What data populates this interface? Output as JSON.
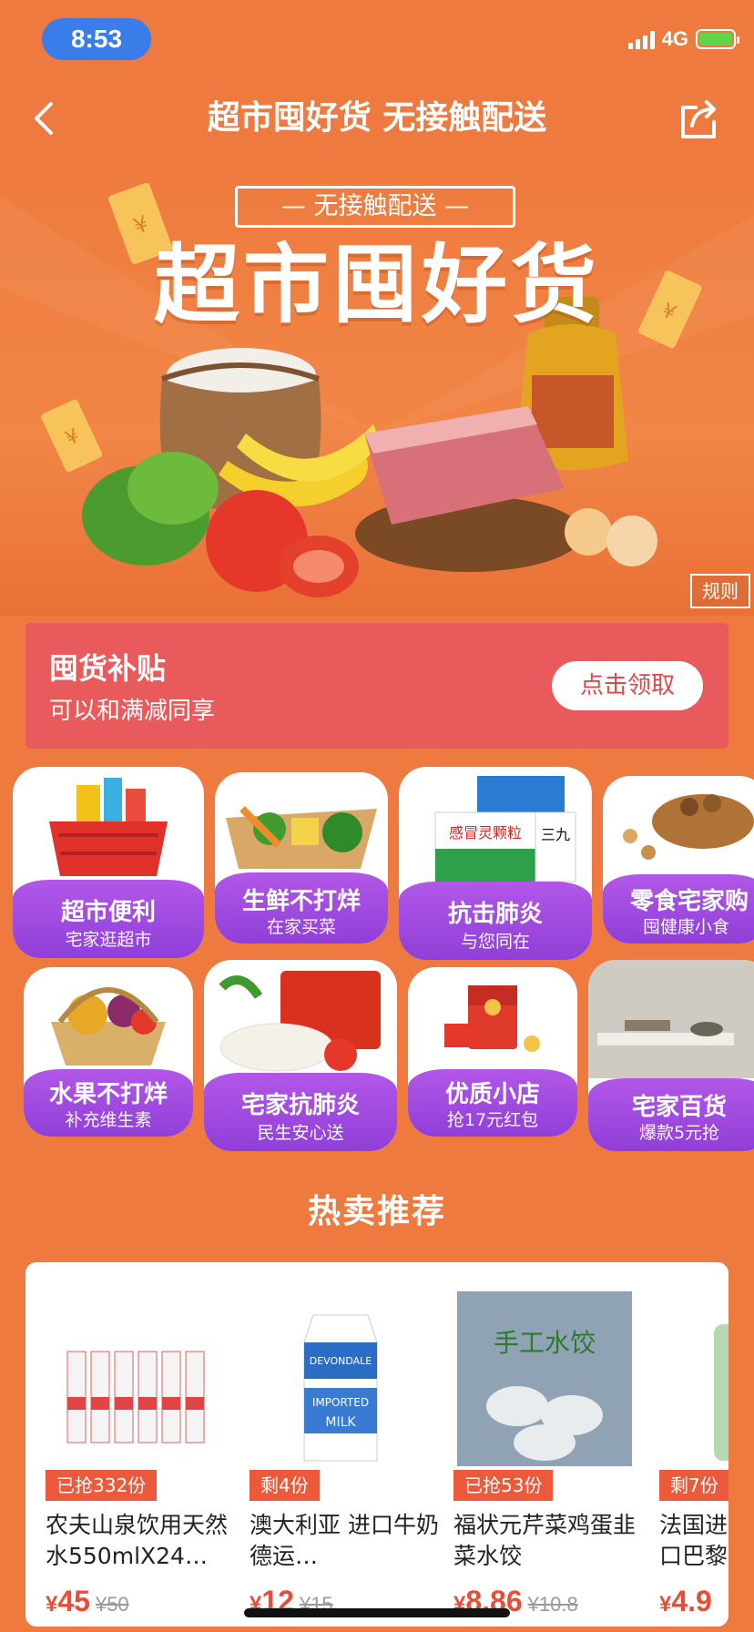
{
  "status": {
    "time": "8:53",
    "network": "4G"
  },
  "nav": {
    "title": "超市囤好货 无接触配送",
    "back_icon": "back-arrow-icon",
    "share_icon": "share-icon"
  },
  "hero": {
    "tag": "— 无接触配送 —",
    "title": "超市囤好货",
    "rules": "规则"
  },
  "coupon": {
    "title": "囤货补贴",
    "subtitle": "可以和满减同享",
    "button": "点击领取"
  },
  "categories": [
    {
      "title": "超市便利",
      "subtitle": "宅家逛超市"
    },
    {
      "title": "生鲜不打烊",
      "subtitle": "在家买菜"
    },
    {
      "title": "抗击肺炎",
      "subtitle": "与您同在"
    },
    {
      "title": "零食宅家购",
      "subtitle": "囤健康小食"
    },
    {
      "title": "水果不打烊",
      "subtitle": "补充维生素"
    },
    {
      "title": "宅家抗肺炎",
      "subtitle": "民生安心送"
    },
    {
      "title": "优质小店",
      "subtitle": "抢17元红包"
    },
    {
      "title": "宅家百货",
      "subtitle": "爆款5元抢"
    }
  ],
  "hot": {
    "title": "热卖推荐",
    "products": [
      {
        "badge": "已抢332份",
        "name": "农夫山泉饮用天然水550mlX24…",
        "yen": "¥",
        "price": "45",
        "orig": "¥50"
      },
      {
        "badge": "剩4份",
        "name": "澳大利亚 进口牛奶 德运…",
        "yen": "¥",
        "price": "12",
        "orig": "¥15"
      },
      {
        "badge": "已抢53份",
        "name": "福状元芹菜鸡蛋韭菜水饺",
        "yen": "¥",
        "price": "8.86",
        "orig": "¥10.8"
      },
      {
        "badge": "剩7份",
        "name": "法国进口巴黎水",
        "yen": "¥",
        "price": "4.9",
        "orig": ""
      }
    ],
    "milk_box_text": {
      "brand": "DEVONDALE",
      "line1": "IMPORTED",
      "line2": "MILK"
    },
    "dumpling_text": "手工水饺"
  },
  "colors": {
    "bg": "#ee7a3f",
    "coupon": "#e95a5c",
    "purple": "#9b47e0",
    "price": "#ec4b37"
  }
}
